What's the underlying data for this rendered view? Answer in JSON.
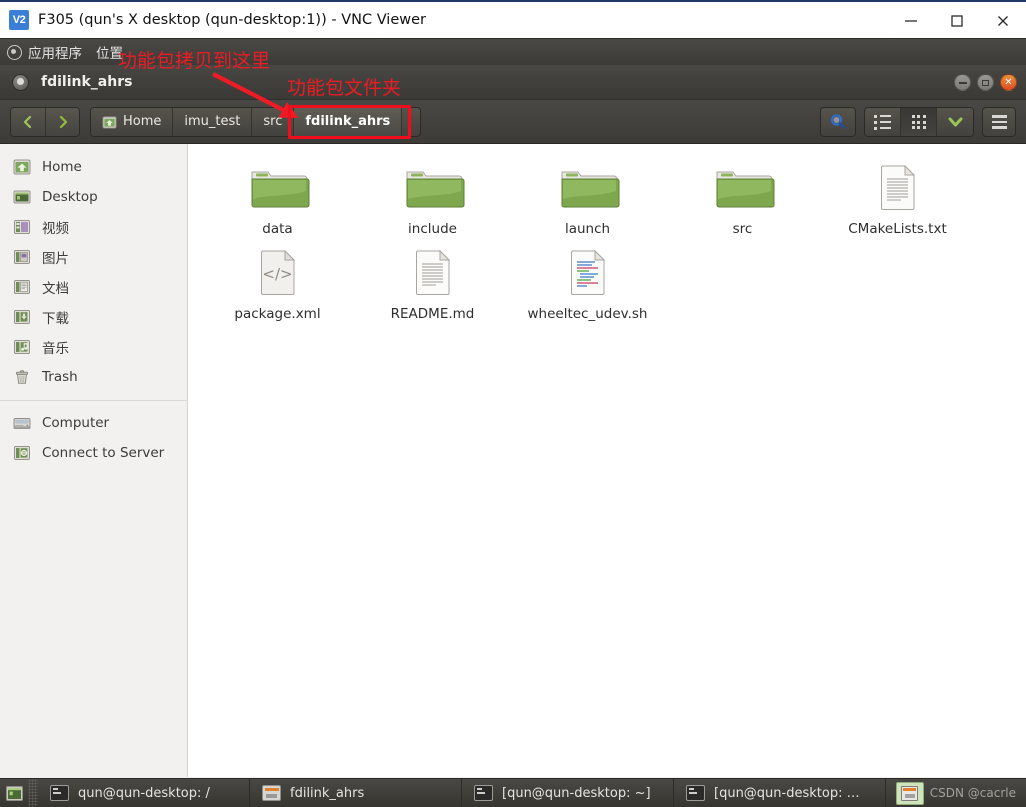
{
  "vnc_window": {
    "logo_text": "V2",
    "title": "F305 (qun's X desktop (qun-desktop:1)) - VNC Viewer",
    "minimize_label": "Minimize",
    "maximize_label": "Maximize",
    "close_label": "Close"
  },
  "gnome_panel": {
    "applications_label": "应用程序",
    "places_label": "位置"
  },
  "file_manager": {
    "window_title": "fdilink_ahrs",
    "minimize_label": "_",
    "maximize_label": "□",
    "close_label": "✕",
    "nav": {
      "back_label": "Back",
      "forward_label": "Forward"
    },
    "breadcrumbs": [
      {
        "label": "Home",
        "icon": "home-folder-icon",
        "current": false
      },
      {
        "label": "imu_test",
        "icon": "",
        "current": false
      },
      {
        "label": "src",
        "icon": "",
        "current": false
      },
      {
        "label": "fdilink_ahrs",
        "icon": "",
        "current": true
      }
    ],
    "toolbar_right": {
      "search_label": "Search",
      "list_view_label": "List view",
      "icon_view_label": "Icon view",
      "view_menu_label": "View options",
      "app_menu_label": "Menu"
    }
  },
  "sidebar": {
    "items": [
      {
        "label": "Home",
        "icon": "home-icon"
      },
      {
        "label": "Desktop",
        "icon": "desktop-icon"
      },
      {
        "label": "视频",
        "icon": "videos-icon"
      },
      {
        "label": "图片",
        "icon": "pictures-icon"
      },
      {
        "label": "文档",
        "icon": "documents-icon"
      },
      {
        "label": "下载",
        "icon": "downloads-icon"
      },
      {
        "label": "音乐",
        "icon": "music-icon"
      },
      {
        "label": "Trash",
        "icon": "trash-icon"
      }
    ],
    "items2": [
      {
        "label": "Computer",
        "icon": "computer-icon"
      },
      {
        "label": "Connect to Server",
        "icon": "network-server-icon"
      }
    ]
  },
  "files": [
    {
      "name": "data",
      "type": "folder"
    },
    {
      "name": "include",
      "type": "folder"
    },
    {
      "name": "launch",
      "type": "folder"
    },
    {
      "name": "src",
      "type": "folder"
    },
    {
      "name": "CMakeLists.txt",
      "type": "text"
    },
    {
      "name": "package.xml",
      "type": "xml"
    },
    {
      "name": "README.md",
      "type": "text"
    },
    {
      "name": "wheeltec_udev.sh",
      "type": "script"
    }
  ],
  "taskbar": {
    "show_desktop_label": "Show Desktop",
    "tasks": [
      {
        "label": "qun@qun-desktop: /",
        "icon": "terminal-icon",
        "active": false
      },
      {
        "label": "fdilink_ahrs",
        "icon": "files-icon",
        "active": false
      },
      {
        "label": "[qun@qun-desktop: ~]",
        "icon": "terminal-icon",
        "active": false
      },
      {
        "label": "[qun@qun-desktop: …",
        "icon": "terminal-icon",
        "active": false
      }
    ],
    "watermark": "CSDN @cacrle"
  },
  "annotations": {
    "copy_here": "功能包拷贝到这里",
    "package_folder": "功能包文件夹",
    "color": "#ec1c24"
  }
}
